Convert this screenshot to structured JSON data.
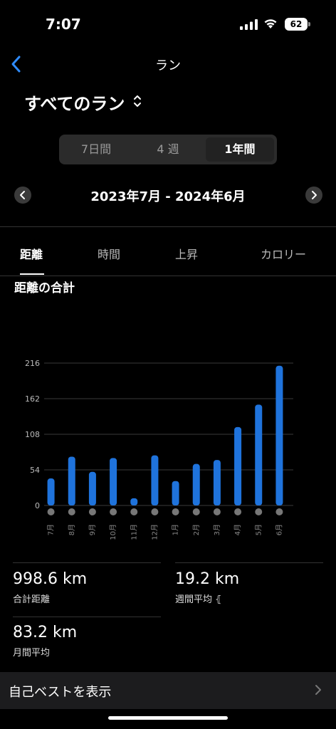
{
  "status": {
    "time": "7:07",
    "battery": "62"
  },
  "nav": {
    "title": "ラン"
  },
  "selector": {
    "label": "すべてのラン"
  },
  "periods": [
    {
      "label": "7日間",
      "active": false
    },
    {
      "label": "4 週",
      "active": false
    },
    {
      "label": "1年間",
      "active": true
    }
  ],
  "date_range": "2023年7月 - 2024年6月",
  "metric_tabs": [
    "距離",
    "時間",
    "上昇",
    "カロリー"
  ],
  "chart_data": {
    "type": "bar",
    "title": "距離の合計",
    "categories": [
      "7月",
      "8月",
      "9月",
      "10月",
      "11月",
      "12月",
      "1月",
      "2月",
      "3月",
      "4月",
      "5月",
      "6月"
    ],
    "values": [
      41,
      74,
      51,
      72,
      11,
      76,
      37,
      63,
      69,
      119,
      153,
      212
    ],
    "yticks": [
      0,
      54,
      108,
      162,
      216
    ],
    "ylim": [
      0,
      216
    ],
    "grid": true,
    "color": "#1f73dc"
  },
  "stats": {
    "total": {
      "value": "998.6 km",
      "label": "合計距離"
    },
    "weekly": {
      "value": "19.2 km",
      "label": "週間平均 ⦃"
    },
    "monthly": {
      "value": "83.2 km",
      "label": "月間平均"
    }
  },
  "best": {
    "label": "自己ベストを表示"
  }
}
